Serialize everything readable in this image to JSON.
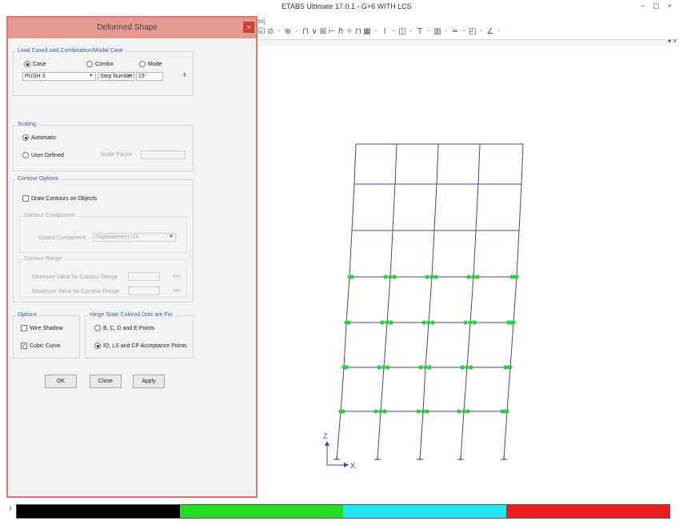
{
  "app": {
    "title": "ETABS Ultimate 17.0.1 - G+6 WITH LCS",
    "menu_stub": "[99]",
    "controls": {
      "minimize": "–",
      "restore": "▢",
      "close": "×"
    }
  },
  "toolbar": {
    "icons": [
      "☑",
      "⊘",
      "·",
      "⊕",
      "·",
      "⊓",
      "∨",
      "⊞",
      "⊢",
      "ℏ",
      "✧",
      "⊓",
      "▦",
      "·",
      "I",
      "·",
      "◫",
      "·",
      "T",
      "·",
      "▥",
      "·",
      "═",
      "·",
      "◰",
      "·",
      "∠",
      "·"
    ]
  },
  "view_close": "▾ ×",
  "dialog": {
    "title": "Deformed Shape",
    "close_icon": "×",
    "load_group": {
      "label": "Load Case/Load Combination/Modal Case",
      "case": "Case",
      "combo": "Combo",
      "mode": "Mode",
      "case_value": "PUSH X",
      "step_label": "Step Number",
      "step_value": "23"
    },
    "scaling": {
      "label": "Scaling",
      "automatic": "Automatic",
      "user_defined": "User Defined",
      "scale_factor": "Scale Factor"
    },
    "contour": {
      "label": "Contour Options",
      "draw": "Draw Contours on Objects",
      "component_label": "Contour Component",
      "output_label": "Output Component",
      "output_value": "Displacement UX",
      "range_label": "Contour Range",
      "min_label": "Minimum Value for Contour Range",
      "max_label": "Maximum Value for Contour Range",
      "unit": "mm"
    },
    "options": {
      "label": "Options",
      "wire_shadow": "Wire Shadow",
      "cubic_curve": "Cubic Curve"
    },
    "hinge": {
      "label": "Hinge State Colored Dots are For",
      "bcde": "B, C, D and E Points",
      "iolscp": "IO, LS and CP Acceptance Points"
    },
    "buttons": {
      "ok": "OK",
      "close": "Close",
      "apply": "Apply"
    }
  },
  "axes": {
    "z": "Z",
    "x": "X"
  },
  "legend": {
    "marker": "I",
    "colors": [
      "#000000",
      "#22dd22",
      "#22e5f5",
      "#ee1c1c"
    ]
  },
  "colors": {
    "frame": "#3a4a9a",
    "hinge": "#2ecc40",
    "dialog_border": "#d97a70",
    "title_bar": "#e49a90"
  }
}
